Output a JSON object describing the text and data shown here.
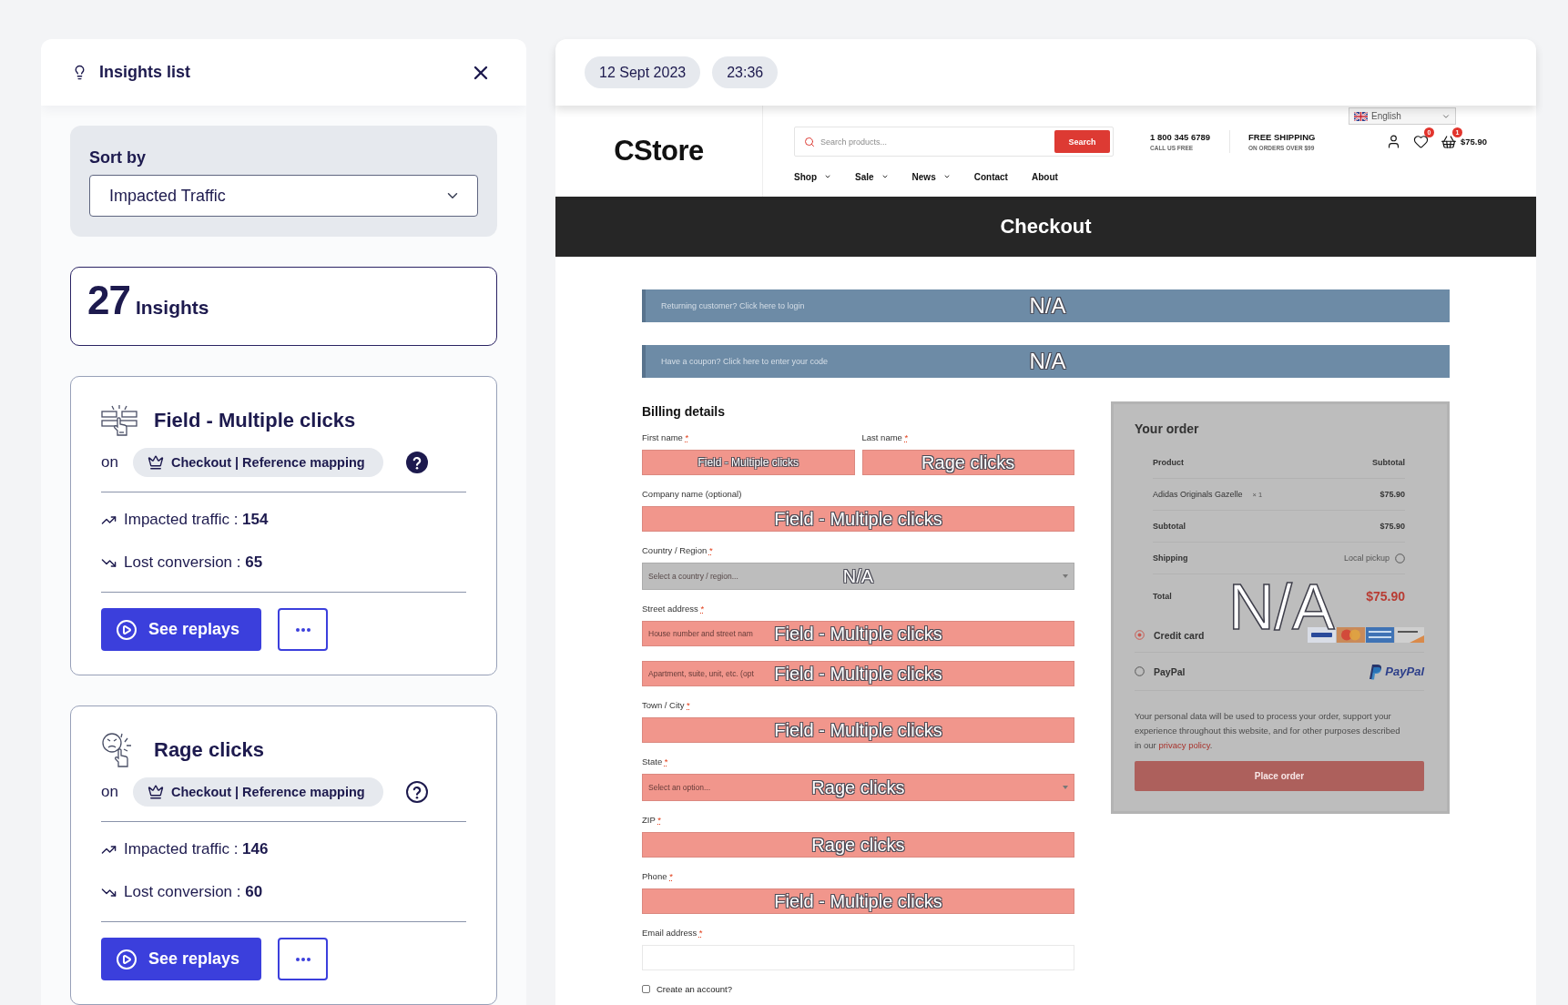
{
  "insights_panel": {
    "title": "Insights list",
    "sort": {
      "label": "Sort by",
      "value": "Impacted Traffic"
    },
    "total": {
      "count": "27",
      "label": "Insights"
    },
    "insights": [
      {
        "kind": "field_clicks",
        "title": "Field - Multiple clicks",
        "on_label": "on",
        "page": "Checkout | Reference mapping",
        "help_filled": true,
        "metrics": [
          {
            "kind": "up",
            "text": "Impacted traffic : **154**"
          },
          {
            "kind": "down",
            "text": "Lost conversion : **65**"
          }
        ],
        "button": "See replays"
      },
      {
        "kind": "rage_clicks",
        "title": "Rage clicks",
        "on_label": "on",
        "page": "Checkout | Reference mapping",
        "help_filled": false,
        "metrics": [
          {
            "kind": "up",
            "text": "Impacted traffic : **146**"
          },
          {
            "kind": "down",
            "text": "Lost conversion : **60**"
          }
        ],
        "button": "See replays"
      }
    ]
  },
  "session": {
    "chips": [
      "12 Sept 2023",
      "23:36"
    ]
  },
  "store": {
    "logo": "CStore",
    "search": {
      "placeholder": "Search products...",
      "button": "Search"
    },
    "contacts": [
      {
        "title": "1 800 345 6789",
        "subtitle": "CALL US FREE"
      },
      {
        "title": "FREE SHIPPING",
        "subtitle": "ON ORDERS OVER $99"
      }
    ],
    "language": "English",
    "wishlist_count": "0",
    "cart_count": "1",
    "cart_total": "$75.90",
    "nav": [
      {
        "label": "Shop",
        "dropdown": true
      },
      {
        "label": "Sale",
        "dropdown": true
      },
      {
        "label": "News",
        "dropdown": true
      },
      {
        "label": "Contact",
        "dropdown": false
      },
      {
        "label": "About",
        "dropdown": false
      }
    ],
    "page_title": "Checkout",
    "notices": [
      {
        "text": "Returning customer? Click here to login",
        "overlay": "N/A"
      },
      {
        "text": "Have a coupon? Click here to enter your code",
        "overlay": "N/A"
      }
    ],
    "billing": {
      "title": "Billing details",
      "groups": [
        {
          "fields": [
            {
              "label": "First name",
              "mark": "*",
              "inputs": [
                {
                  "kind": "text",
                  "color": "#f1968c",
                  "overlay": "Field - Multiple clicks"
                }
              ]
            },
            {
              "label": "Last name",
              "mark": "*",
              "inputs": [
                {
                  "kind": "text",
                  "color": "#f1968c",
                  "overlay": "Rage clicks"
                }
              ]
            }
          ]
        },
        {
          "fields": [
            {
              "label": "Company name (optional)",
              "inputs": [
                {
                  "kind": "text",
                  "color": "#f1968c",
                  "overlay": "Field - Multiple clicks"
                }
              ]
            }
          ]
        },
        {
          "fields": [
            {
              "label": "Country / Region",
              "mark": "*",
              "inputs": [
                {
                  "kind": "select",
                  "color": "#bdbdbd",
                  "placeholder": "Select a country / region...",
                  "overlay": "N/A"
                }
              ]
            }
          ]
        },
        {
          "fields": [
            {
              "label": "Street address",
              "mark": "*",
              "inputs": [
                {
                  "kind": "text",
                  "color": "#f1968c",
                  "placeholder": "House number and street nam",
                  "overlay": "Field - Multiple clicks"
                },
                {
                  "kind": "text",
                  "color": "#f1968c",
                  "placeholder": "Apartment, suite, unit, etc. (opt",
                  "overlay": "Field - Multiple clicks"
                }
              ]
            }
          ]
        },
        {
          "fields": [
            {
              "label": "Town / City",
              "mark": "*",
              "inputs": [
                {
                  "kind": "text",
                  "color": "#f1968c",
                  "overlay": "Field - Multiple clicks"
                }
              ]
            }
          ]
        },
        {
          "fields": [
            {
              "label": "State",
              "mark": "*",
              "inputs": [
                {
                  "kind": "select",
                  "color": "#f1968c",
                  "placeholder": "Select an option...",
                  "overlay": "Rage clicks"
                }
              ]
            }
          ]
        },
        {
          "fields": [
            {
              "label": "ZIP",
              "mark": "*",
              "inputs": [
                {
                  "kind": "text",
                  "color": "#f1968c",
                  "overlay": "Rage clicks"
                }
              ]
            }
          ]
        },
        {
          "fields": [
            {
              "label": "Phone",
              "mark": "*",
              "inputs": [
                {
                  "kind": "text",
                  "color": "#f1968c",
                  "overlay": "Field - Multiple clicks"
                }
              ]
            }
          ]
        },
        {
          "fields": [
            {
              "label": "Email address",
              "mark": "*",
              "inputs": [
                {
                  "kind": "text",
                  "color": "#ffffff"
                }
              ]
            }
          ]
        }
      ],
      "account": {
        "label": "Create an account?",
        "checked": false
      }
    },
    "order": {
      "title": "Your order",
      "overlay": "N/A",
      "head": [
        "Product",
        "Subtotal"
      ],
      "lines": [
        {
          "kind": "item",
          "label": "Adidas Originals Gazelle",
          "qty": "× 1",
          "value": "$75.90"
        },
        {
          "kind": "subtotal",
          "label": "Subtotal",
          "value": "$75.90"
        },
        {
          "kind": "shipping",
          "label": "Shipping",
          "value": "Local pickup",
          "selected": false
        },
        {
          "kind": "total",
          "label": "Total",
          "value": "$75.90"
        }
      ],
      "payments": [
        {
          "kind": "cards",
          "label": "Credit card",
          "selected": true
        },
        {
          "kind": "paypal",
          "label": "PayPal",
          "logo": "PayPal",
          "selected": false
        }
      ],
      "privacy": {
        "lines": [
          "Your personal data will be used to process your order, support your",
          "experience throughout this website, and for other purposes described",
          "in our"
        ],
        "link": "privacy policy",
        "end": "."
      },
      "button": "Place order"
    }
  }
}
